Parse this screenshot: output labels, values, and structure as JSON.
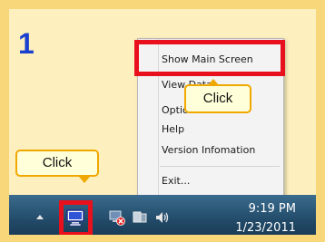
{
  "step_number": "1",
  "context_menu": {
    "items": [
      {
        "label": "Show Main Screen"
      },
      {
        "label": "View Data"
      },
      {
        "label": "Options"
      },
      {
        "label": "Help"
      },
      {
        "label": "Version Infomation"
      },
      {
        "label": "Exit..."
      }
    ]
  },
  "callouts": {
    "menu_click": "Click",
    "tray_click": "Click"
  },
  "taskbar": {
    "time": "9:19 PM",
    "date": "1/23/2011"
  },
  "colors": {
    "highlight_red": "#e8101d",
    "callout_border": "#f0a800",
    "step_blue": "#1b3fcf"
  }
}
